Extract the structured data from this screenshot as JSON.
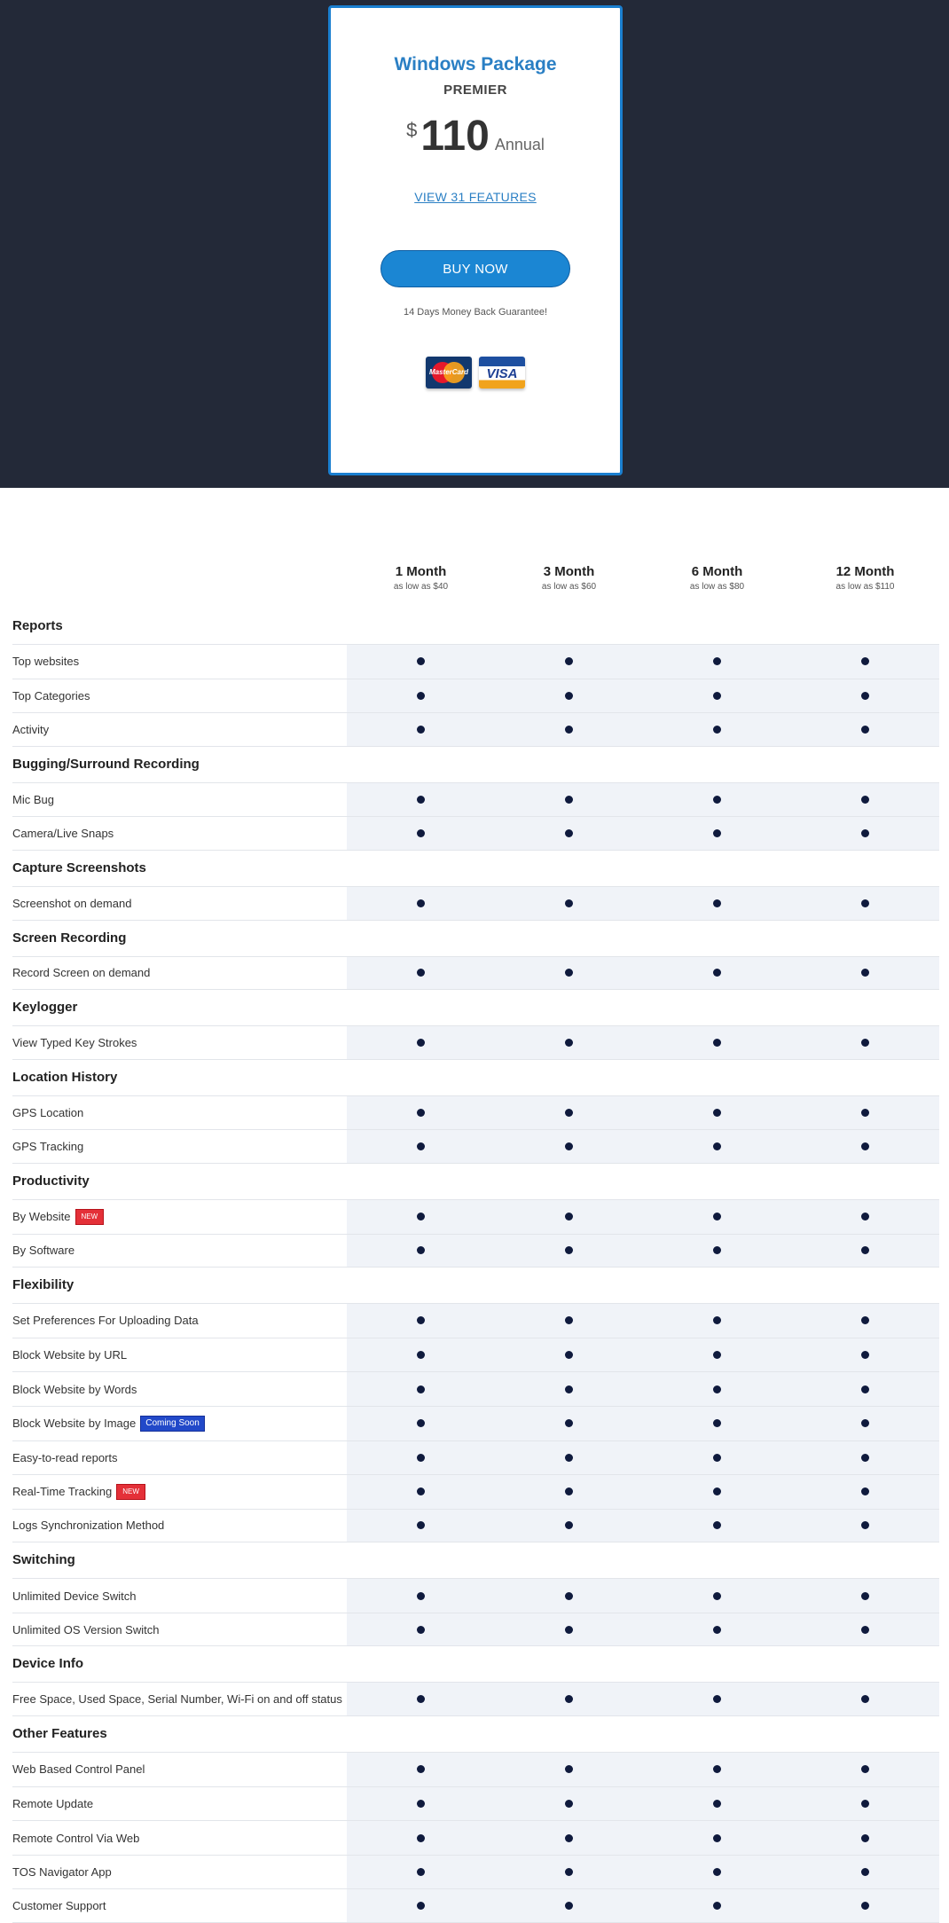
{
  "package": {
    "title": "Windows Package",
    "subtitle": "PREMIER",
    "currency": "$",
    "amount": "110",
    "period": "Annual",
    "features_link": "VIEW 31 FEATURES",
    "buy_label": "BUY NOW",
    "guarantee": "14 Days Money Back Guarantee!",
    "payment_cards": [
      {
        "name": "mastercard-icon",
        "label": "MasterCard"
      },
      {
        "name": "visa-icon",
        "label": "VISA"
      }
    ]
  },
  "columns": [
    {
      "name": "1 Month",
      "sub": "as low as $40"
    },
    {
      "name": "3 Month",
      "sub": "as low as $60"
    },
    {
      "name": "6 Month",
      "sub": "as low as $80"
    },
    {
      "name": "12 Month",
      "sub": "as low as $110"
    }
  ],
  "groups": [
    {
      "title": "Reports",
      "rows": [
        {
          "label": "Top websites"
        },
        {
          "label": "Top Categories"
        },
        {
          "label": "Activity"
        }
      ]
    },
    {
      "title": "Bugging/Surround Recording",
      "rows": [
        {
          "label": "Mic Bug"
        },
        {
          "label": "Camera/Live Snaps"
        }
      ]
    },
    {
      "title": "Capture Screenshots",
      "rows": [
        {
          "label": "Screenshot on demand"
        }
      ]
    },
    {
      "title": "Screen Recording",
      "rows": [
        {
          "label": "Record Screen on demand"
        }
      ]
    },
    {
      "title": "Keylogger",
      "rows": [
        {
          "label": "View Typed Key Strokes"
        }
      ]
    },
    {
      "title": "Location History",
      "rows": [
        {
          "label": "GPS Location"
        },
        {
          "label": "GPS Tracking"
        }
      ]
    },
    {
      "title": "Productivity",
      "rows": [
        {
          "label": "By Website",
          "badge": "NEW",
          "badge_type": "new"
        },
        {
          "label": "By Software"
        }
      ]
    },
    {
      "title": "Flexibility",
      "rows": [
        {
          "label": "Set Preferences For Uploading Data"
        },
        {
          "label": "Block Website by URL"
        },
        {
          "label": "Block Website by Words"
        },
        {
          "label": "Block Website by Image",
          "badge": "Coming Soon",
          "badge_type": "soon"
        },
        {
          "label": "Easy-to-read reports"
        },
        {
          "label": "Real-Time Tracking",
          "badge": "NEW",
          "badge_type": "new"
        },
        {
          "label": "Logs Synchronization Method"
        }
      ]
    },
    {
      "title": "Switching",
      "rows": [
        {
          "label": "Unlimited Device Switch"
        },
        {
          "label": "Unlimited OS Version Switch"
        }
      ]
    },
    {
      "title": "Device Info",
      "rows": [
        {
          "label": "Free Space, Used Space, Serial Number, Wi-Fi on and off status"
        }
      ]
    },
    {
      "title": "Other Features",
      "rows": [
        {
          "label": "Web Based Control Panel"
        },
        {
          "label": "Remote Update"
        },
        {
          "label": "Remote Control Via Web"
        },
        {
          "label": "TOS Navigator App"
        },
        {
          "label": "Customer Support"
        }
      ]
    }
  ]
}
